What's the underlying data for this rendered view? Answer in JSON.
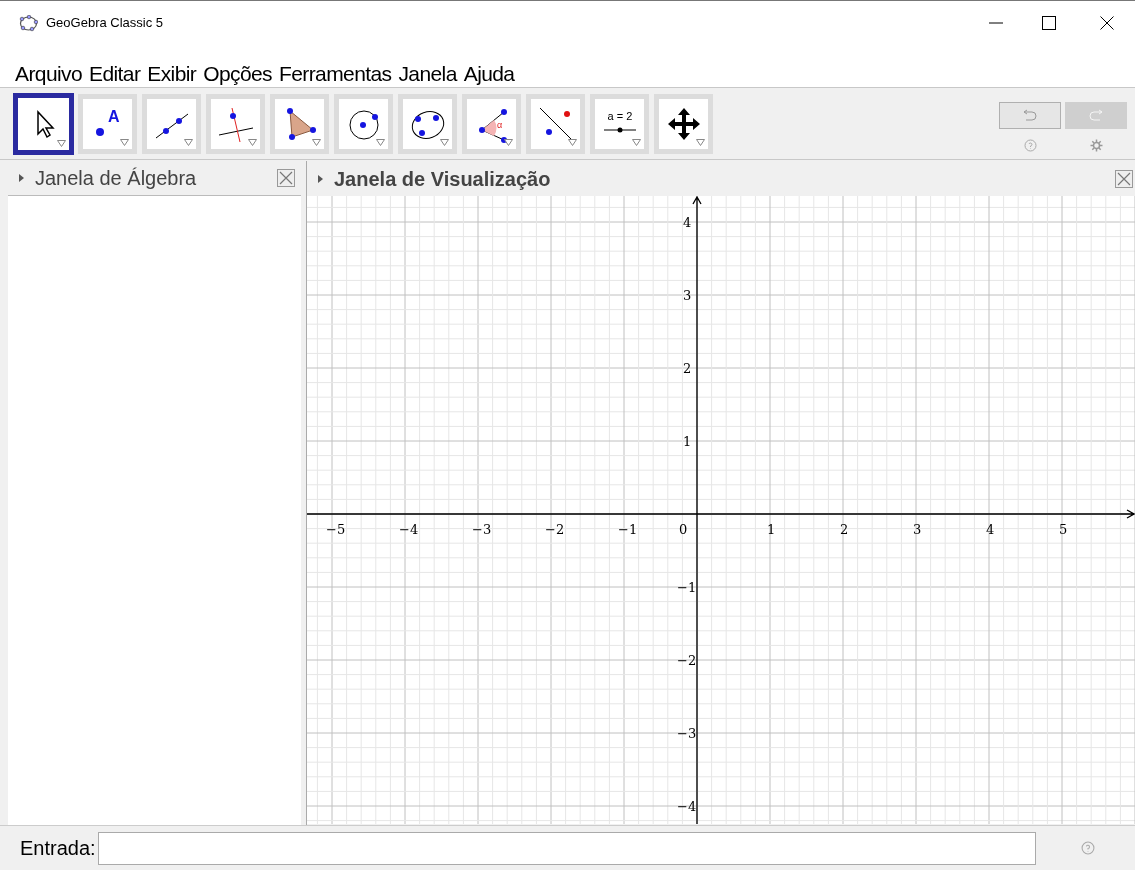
{
  "window": {
    "title": "GeoGebra Classic 5"
  },
  "menu": [
    "Arquivo",
    "Editar",
    "Exibir",
    "Opções",
    "Ferramentas",
    "Janela",
    "Ajuda"
  ],
  "tools": [
    {
      "kind": "move",
      "selected": true
    },
    {
      "kind": "point",
      "selected": false,
      "label": "A"
    },
    {
      "kind": "line",
      "selected": false
    },
    {
      "kind": "perpendicular",
      "selected": false
    },
    {
      "kind": "polygon",
      "selected": false
    },
    {
      "kind": "circle",
      "selected": false
    },
    {
      "kind": "conic",
      "selected": false
    },
    {
      "kind": "angle",
      "selected": false,
      "label": "α"
    },
    {
      "kind": "reflect",
      "selected": false
    },
    {
      "kind": "slider",
      "selected": false,
      "label": "a = 2"
    },
    {
      "kind": "pan",
      "selected": false
    }
  ],
  "history": [
    {
      "kind": "undo",
      "disabled": false
    },
    {
      "kind": "redo",
      "disabled": true
    }
  ],
  "algebra_view": {
    "title": "Janela de Álgebra"
  },
  "graphics_view": {
    "title": "Janela de Visualização",
    "x_axis": {
      "negative": [
        "−5",
        "−4",
        "−3",
        "−2",
        "−1"
      ],
      "origin": "0",
      "positive": [
        "1",
        "2",
        "3",
        "4",
        "5"
      ]
    },
    "y_axis": {
      "positive": [
        "4",
        "3",
        "2",
        "1"
      ],
      "negative": [
        "−1",
        "−2",
        "−3",
        "−4"
      ]
    }
  },
  "input_bar": {
    "label": "Entrada:"
  }
}
